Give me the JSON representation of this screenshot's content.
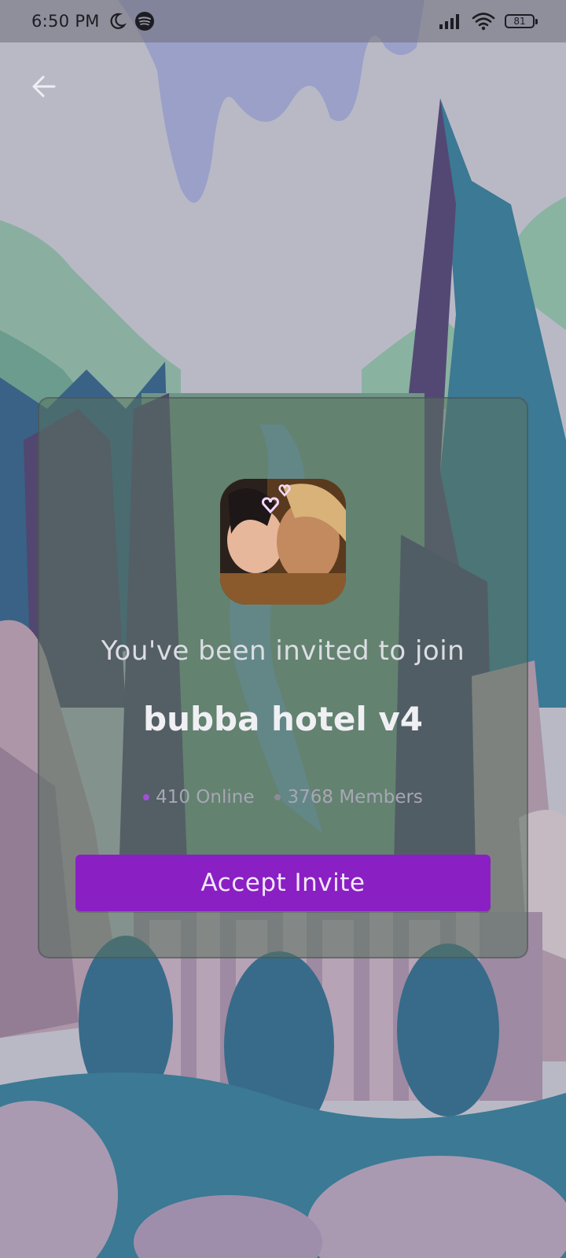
{
  "status_bar": {
    "time": "6:50 PM",
    "battery": "81",
    "icons": [
      "moon-icon",
      "spotify-icon",
      "signal-icon",
      "wifi-icon",
      "battery-icon"
    ]
  },
  "navigation": {
    "back_icon": "arrow-left-icon"
  },
  "invite": {
    "heading": "You've been invited to join",
    "server_name": "bubba hotel v4",
    "online_count": "410 Online",
    "member_count": "3768 Members",
    "accept_label": "Accept Invite"
  },
  "colors": {
    "accept_button": "#8a1fc4",
    "online_dot": "#a24fd6",
    "members_dot": "#8c8c98"
  }
}
